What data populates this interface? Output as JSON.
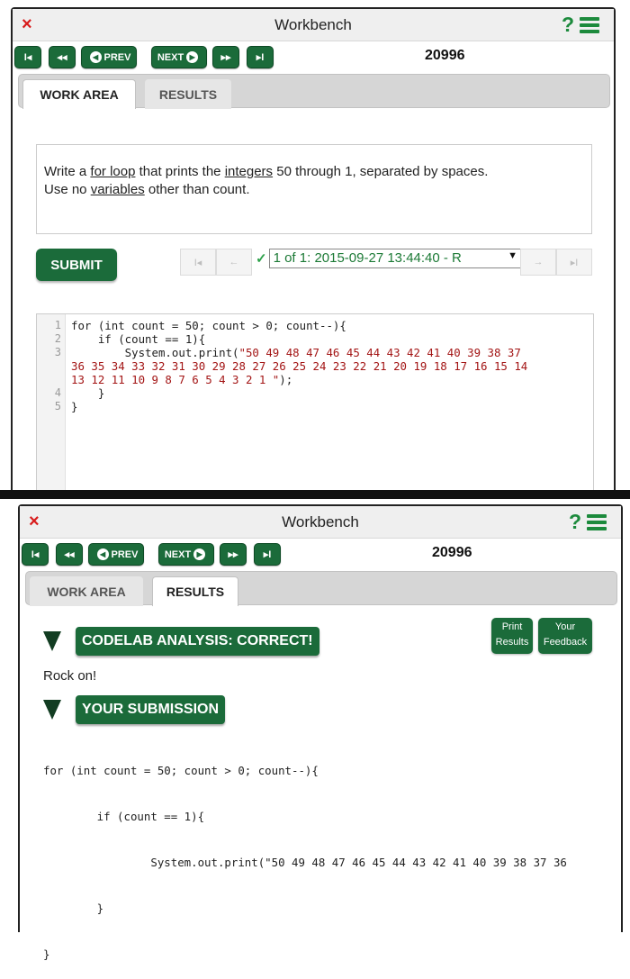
{
  "app": {
    "title": "Workbench",
    "close_glyph": "×",
    "help_glyph": "?",
    "problem_number": "20996"
  },
  "nav": {
    "first": "I◂",
    "back_fast": "◂◂",
    "prev": "PREV",
    "next": "NEXT",
    "forward_fast": "▸▸",
    "last": "▸I"
  },
  "tabs": {
    "work_area": "WORK AREA",
    "results": "RESULTS"
  },
  "question": {
    "parts": [
      "Write a ",
      "for loop",
      "  that prints the ",
      "integers",
      "  50 through 1, separated by spaces."
    ],
    "line2_parts": [
      "Use no ",
      "variables",
      "  other than count."
    ]
  },
  "submit_label": "SUBMIT",
  "submission": {
    "check": "✓",
    "selected": "1 of 1: 2015-09-27 13:44:40 - R",
    "arrow": "▼",
    "nav_first": "I◂",
    "nav_prev": "←",
    "nav_next": "→",
    "nav_last": "▸I"
  },
  "editor": {
    "line_numbers": [
      "1",
      "2",
      "3",
      "",
      "",
      "4",
      "5"
    ],
    "lines": [
      "for (int count = 50; count > 0; count--){",
      "    if (count == 1){",
      "        System.out.print(",
      "\"50 49 48 47 46 45 44 43 42 41 40 39 38 37",
      "36 35 34 33 32 31 30 29 28 27 26 25 24 23 22 21 20 19 18 17 16 15 14",
      "13 12 11 10 9 8 7 6 5 4 3 2 1 \"",
      ");",
      "    }",
      "}"
    ]
  },
  "results": {
    "analysis_banner": "CODELAB ANALYSIS: CORRECT!",
    "print_button": [
      "Print",
      "Results"
    ],
    "feedback_button": [
      "Your",
      "Feedback"
    ],
    "message": "Rock on!",
    "submission_banner": "YOUR SUBMISSION",
    "code": [
      "for (int count = 50; count > 0; count--){",
      "        if (count == 1){",
      "                System.out.print(\"50 49 48 47 46 45 44 43 42 41 40 39 38 37 36",
      "        }",
      "}"
    ]
  },
  "colors": {
    "accent_green": "#1b6b3a",
    "close_red": "#d81b1b",
    "string_red": "#a31515",
    "check_green": "#2da14a"
  }
}
